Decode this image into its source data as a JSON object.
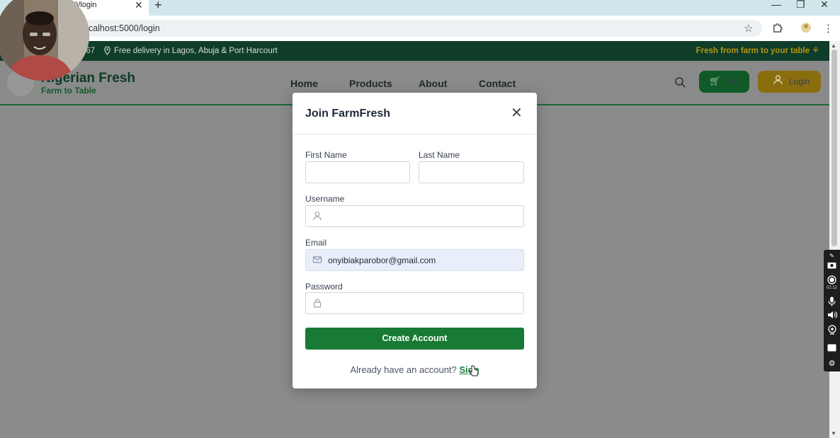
{
  "browser": {
    "tab_title": "00/login",
    "tab_close": "✕",
    "new_tab": "+",
    "url": "ocalhost:5000/login",
    "minimize": "—",
    "maximize": "❐",
    "close": "✕"
  },
  "topbar": {
    "phone": "567",
    "delivery": "Free delivery in Lagos, Abuja & Port Harcourt",
    "tagline": "Fresh from farm to your table"
  },
  "header": {
    "brand": "Nigerian Fresh",
    "brand_sub": "Farm to Table",
    "nav": [
      "Home",
      "Products",
      "About",
      "Contact"
    ],
    "cart_label": "Cart",
    "login_label": "Login"
  },
  "modal": {
    "title": "Join FarmFresh",
    "close": "✕",
    "first_name_label": "First Name",
    "last_name_label": "Last Name",
    "username_label": "Username",
    "email_label": "Email",
    "email_value": "onyibiakparobor@gmail.com",
    "password_label": "Password",
    "create_button": "Create Account",
    "signin_prompt": "Already have an account?",
    "signin_link": "Sign"
  },
  "side_tools": {
    "timer": "02:12"
  },
  "colors": {
    "primary_green": "#187a34",
    "dark_green": "#0f3d2a",
    "gold": "#b7940f"
  }
}
